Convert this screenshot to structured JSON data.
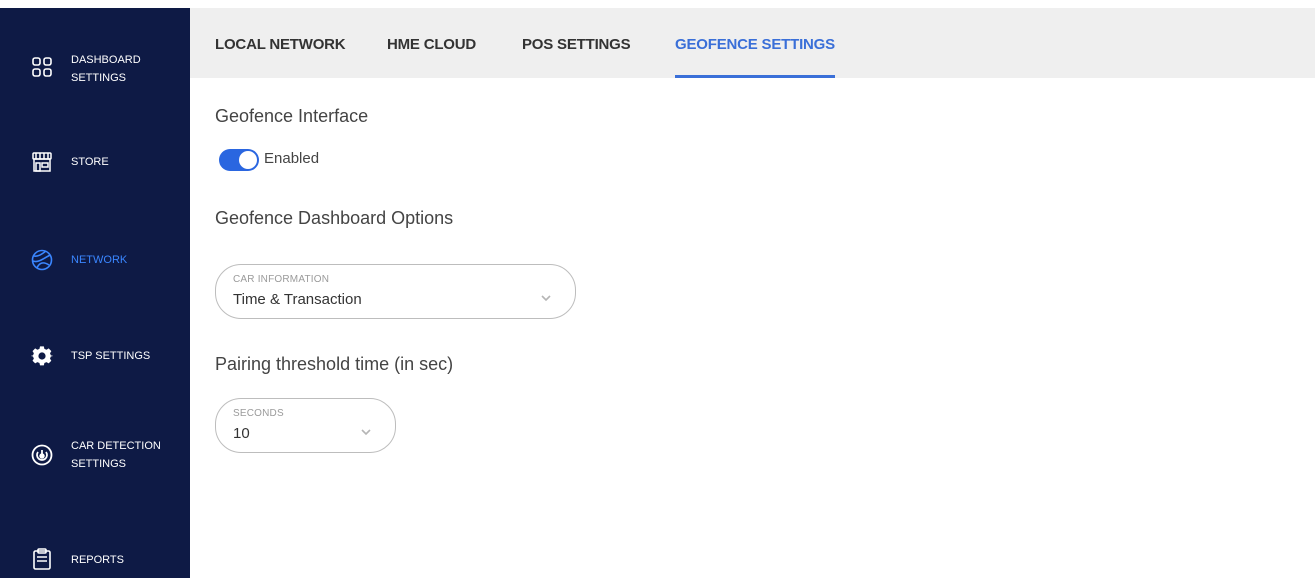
{
  "sidebar": {
    "items": [
      {
        "label": "DASHBOARD\nSETTINGS",
        "icon": "grid-icon",
        "active": false
      },
      {
        "label": "STORE",
        "icon": "storefront-icon",
        "active": false
      },
      {
        "label": "NETWORK",
        "icon": "globe-icon",
        "active": true
      },
      {
        "label": "TSP SETTINGS",
        "icon": "gear-icon",
        "active": false
      },
      {
        "label": "CAR DETECTION\nSETTINGS",
        "icon": "radar-icon",
        "active": false
      },
      {
        "label": "REPORTS",
        "icon": "clipboard-icon",
        "active": false
      }
    ]
  },
  "tabs": [
    {
      "label": "LOCAL NETWORK",
      "active": false
    },
    {
      "label": "HME CLOUD",
      "active": false
    },
    {
      "label": "POS SETTINGS",
      "active": false
    },
    {
      "label": "GEOFENCE SETTINGS",
      "active": true
    }
  ],
  "geofence_interface": {
    "title": "Geofence Interface",
    "toggle_label": "Enabled",
    "enabled": true
  },
  "dashboard_options": {
    "title": "Geofence Dashboard Options",
    "car_information": {
      "caption": "CAR INFORMATION",
      "value": "Time & Transaction"
    }
  },
  "pairing_threshold": {
    "title": "Pairing threshold time (in sec)",
    "seconds": {
      "caption": "SECONDS",
      "value": "10"
    }
  },
  "colors": {
    "sidebar_bg": "#0e1a45",
    "accent": "#3a6fd8",
    "toggle_on": "#2a66e0",
    "tabbar_bg": "#efefef"
  }
}
